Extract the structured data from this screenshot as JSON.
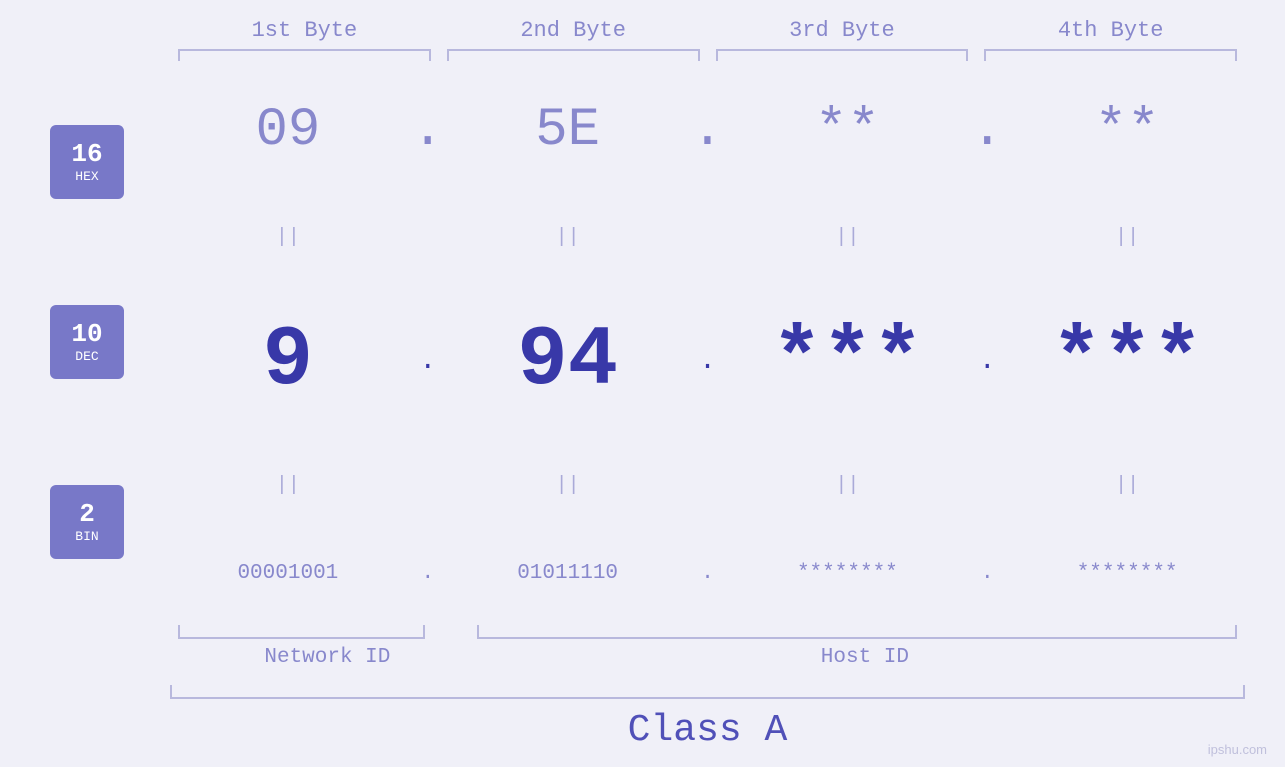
{
  "headers": {
    "byte1": "1st Byte",
    "byte2": "2nd Byte",
    "byte3": "3rd Byte",
    "byte4": "4th Byte"
  },
  "badges": [
    {
      "number": "16",
      "label": "HEX"
    },
    {
      "number": "10",
      "label": "DEC"
    },
    {
      "number": "2",
      "label": "BIN"
    }
  ],
  "hex_row": {
    "b1": "09",
    "b2": "5E",
    "b3": "**",
    "b4": "**",
    "sep": "."
  },
  "dec_row": {
    "b1": "9",
    "b2": "94",
    "b3": "***",
    "b4": "***",
    "sep": "."
  },
  "bin_row": {
    "b1": "00001001",
    "b2": "01011110",
    "b3": "********",
    "b4": "********",
    "sep": "."
  },
  "labels": {
    "network_id": "Network ID",
    "host_id": "Host ID",
    "class": "Class A"
  },
  "watermark": "ipshu.com",
  "colors": {
    "bg": "#f0f0f8",
    "badge": "#7878c8",
    "hex_color": "#8888cc",
    "dec_color": "#3838a8",
    "sep_color_hex": "#8888cc",
    "sep_color_dec": "#3838a8",
    "bracket_color": "#b8b8dd",
    "label_color": "#8888cc",
    "class_color": "#5050b8"
  }
}
